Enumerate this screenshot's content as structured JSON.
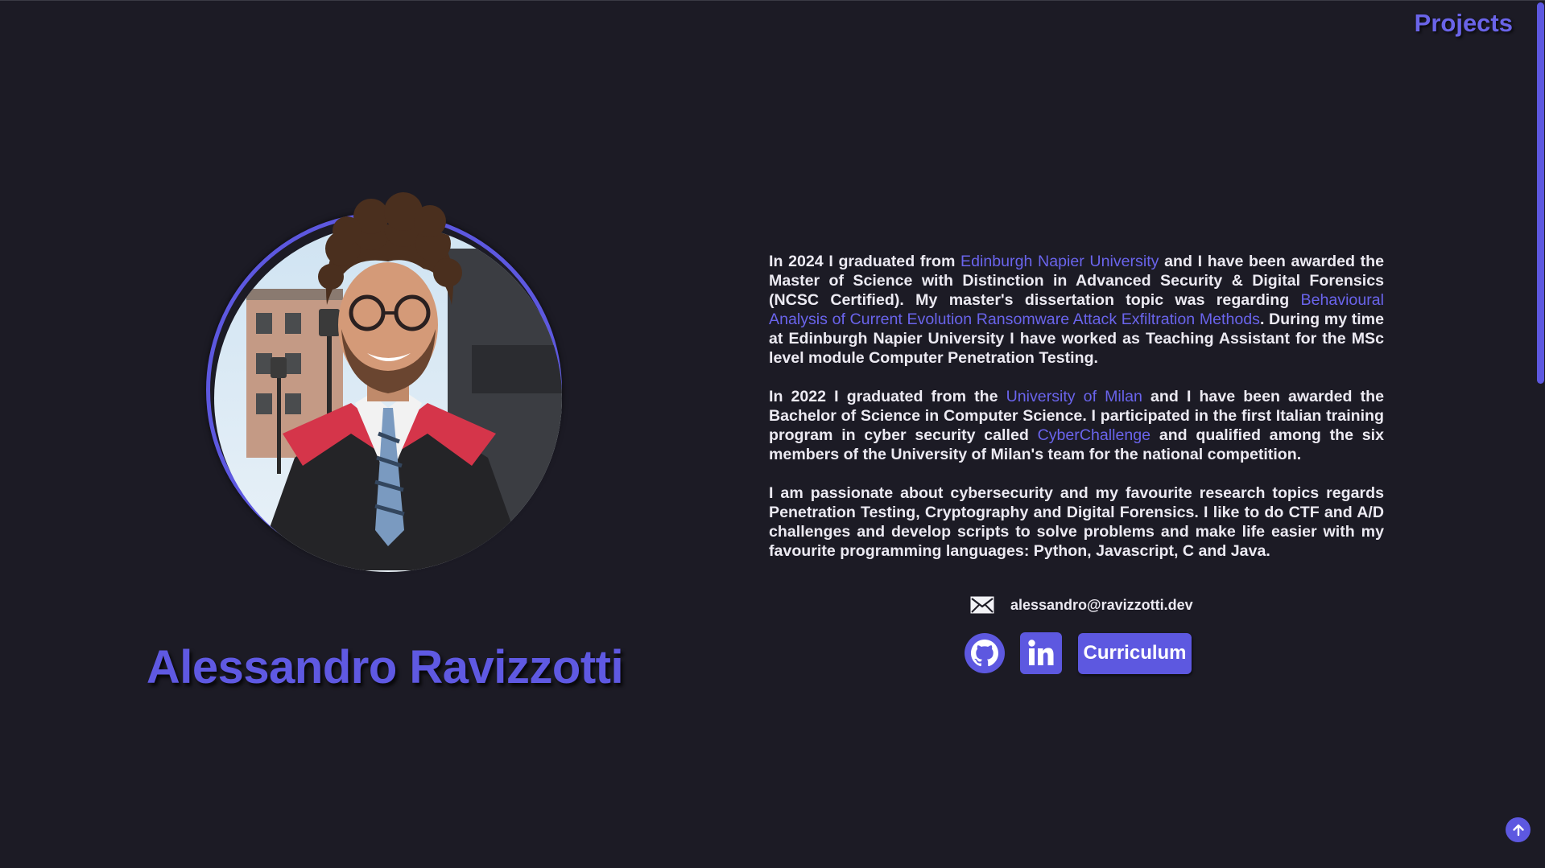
{
  "nav": {
    "projects_label": "Projects"
  },
  "profile": {
    "name": "Alessandro Ravizzotti",
    "photo_icon": "graduation-portrait"
  },
  "bio": {
    "p1": {
      "t1": "In 2024 I graduated from ",
      "link1": "Edinburgh Napier University",
      "t2": " and I have been awarded the Master of Science with Distinction in Advanced Security & Digital Forensics (NCSC Certified). My master's dissertation topic was regarding ",
      "link2": "Behavioural Analysis of Current Evolution Ransomware Attack Exfiltration Methods",
      "t3": ". During my time at Edinburgh Napier University I have worked as Teaching Assistant for the MSc level module Computer Penetration Testing."
    },
    "p2": {
      "t1": "In 2022 I graduated from the ",
      "link1": "University of Milan",
      "t2": " and I have been awarded the Bachelor of Science in Computer Science. I participated in the first Italian training program in cyber security called ",
      "link2": "CyberChallenge",
      "t3": " and qualified among the six members of the University of Milan's team for the national competition."
    },
    "p3": "I am passionate about cybersecurity and my favourite research topics regards Penetration Testing, Cryptography and Digital Forensics. I like to do CTF and A/D challenges and develop scripts to solve problems and make life easier with my favourite programming languages: Python, Javascript, C and Java."
  },
  "contact": {
    "email": "alessandro@ravizzotti.dev",
    "email_icon": "mail-icon"
  },
  "social": {
    "github_icon": "github-icon",
    "linkedin_icon": "linkedin-icon",
    "curriculum_label": "Curriculum"
  },
  "colors": {
    "background": "#1c1b25",
    "accent": "#5d58e0",
    "link": "#6a64ec",
    "text": "#eceaf2"
  },
  "scroll_to_top_icon": "arrow-up-icon"
}
